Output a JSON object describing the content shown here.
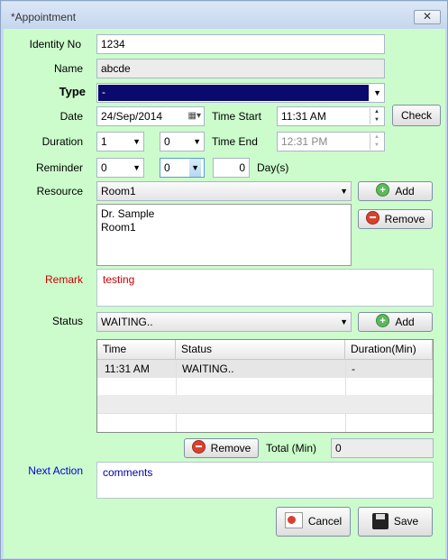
{
  "window": {
    "title": "*Appointment",
    "close_label": "✕"
  },
  "form": {
    "identity_label": "Identity No",
    "identity_value": "1234",
    "name_label": "Name",
    "name_value": "abcde",
    "type_label": "Type",
    "type_value": "-",
    "date_label": "Date",
    "date_value": "24/Sep/2014",
    "time_start_label": "Time Start",
    "time_start_value": "11:31 AM",
    "check_label": "Check",
    "duration_label": "Duration",
    "duration_hours": "1",
    "duration_minutes": "0",
    "time_end_label": "Time End",
    "time_end_value": "12:31 PM",
    "reminder_label": "Reminder",
    "reminder_a": "0",
    "reminder_b": "0",
    "reminder_days_value": "0",
    "reminder_days_label": "Day(s)",
    "resource_label": "Resource",
    "resource_value": "Room1",
    "resource_add_label": "Add",
    "resource_remove_label": "Remove",
    "resource_list": [
      "Dr. Sample",
      "Room1"
    ],
    "remark_label": "Remark",
    "remark_value": "testing",
    "status_label": "Status",
    "status_value": "WAITING..",
    "status_add_label": "Add",
    "table_headers": [
      "Time",
      "Status",
      "Duration(Min)"
    ],
    "table_rows": [
      {
        "time": "11:31 AM",
        "status": "WAITING..",
        "duration": "-"
      }
    ],
    "status_remove_label": "Remove",
    "total_label": "Total (Min)",
    "total_value": "0",
    "next_action_label": "Next Action",
    "next_action_value": "comments",
    "cancel_label": "Cancel",
    "save_label": "Save"
  },
  "colors": {
    "body_bg": "#ccfccc",
    "type_bg": "#0a0a6e",
    "remark_label": "#cc0000",
    "next_action_label": "#0000cc"
  }
}
